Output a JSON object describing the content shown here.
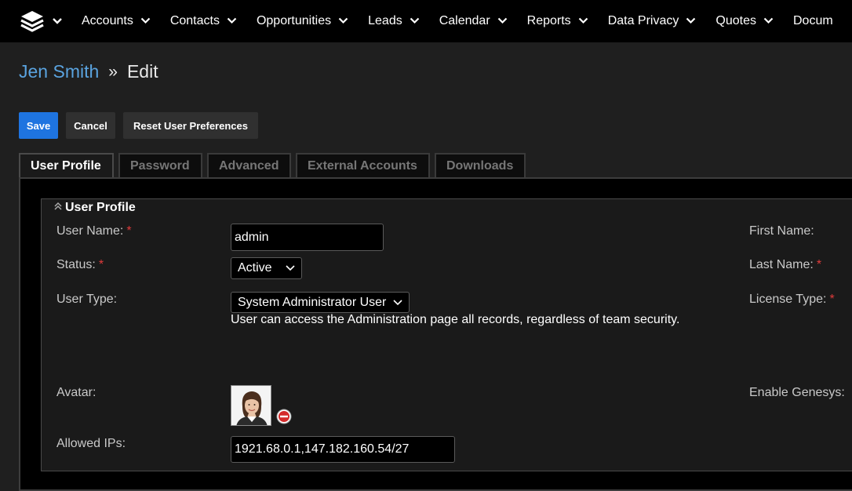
{
  "nav": {
    "logo_icon": "stacked-layers-logo",
    "items": [
      {
        "label": "Accounts"
      },
      {
        "label": "Contacts"
      },
      {
        "label": "Opportunities"
      },
      {
        "label": "Leads"
      },
      {
        "label": "Calendar"
      },
      {
        "label": "Reports"
      },
      {
        "label": "Data Privacy"
      },
      {
        "label": "Quotes"
      },
      {
        "label": "Docum"
      }
    ]
  },
  "breadcrumb": {
    "record": "Jen Smith",
    "separator": "»",
    "current": "Edit"
  },
  "toolbar": {
    "save_label": "Save",
    "cancel_label": "Cancel",
    "reset_label": "Reset User Preferences"
  },
  "tabs": [
    {
      "label": "User Profile",
      "active": true
    },
    {
      "label": "Password"
    },
    {
      "label": "Advanced"
    },
    {
      "label": "External Accounts"
    },
    {
      "label": "Downloads"
    }
  ],
  "section": {
    "title": "User Profile",
    "collapse_icon": "double-chevron-up-icon"
  },
  "form": {
    "user_name": {
      "label": "User Name:",
      "required": "*",
      "value": "admin"
    },
    "status": {
      "label": "Status:",
      "required": "*",
      "value": "Active"
    },
    "user_type": {
      "label": "User Type:",
      "value": "System Administrator User",
      "help": "User can access the Administration page all records, regardless of team security."
    },
    "avatar": {
      "label": "Avatar:",
      "image": "user-portrait-photo"
    },
    "allowed_ips": {
      "label": "Allowed IPs:",
      "value": "1921.68.0.1,147.182.160.54/27"
    },
    "first_name": {
      "label": "First Name:"
    },
    "last_name": {
      "label": "Last Name:",
      "required": "*"
    },
    "license_type": {
      "label": "License Type:",
      "required": "*"
    },
    "enable_genesys": {
      "label": "Enable Genesys:"
    }
  },
  "colors": {
    "nav_bg": "#000000",
    "page_bg": "#1f1f1f",
    "link": "#5aa3df",
    "primary_button": "#1e74e0",
    "required": "#e03b3b"
  }
}
